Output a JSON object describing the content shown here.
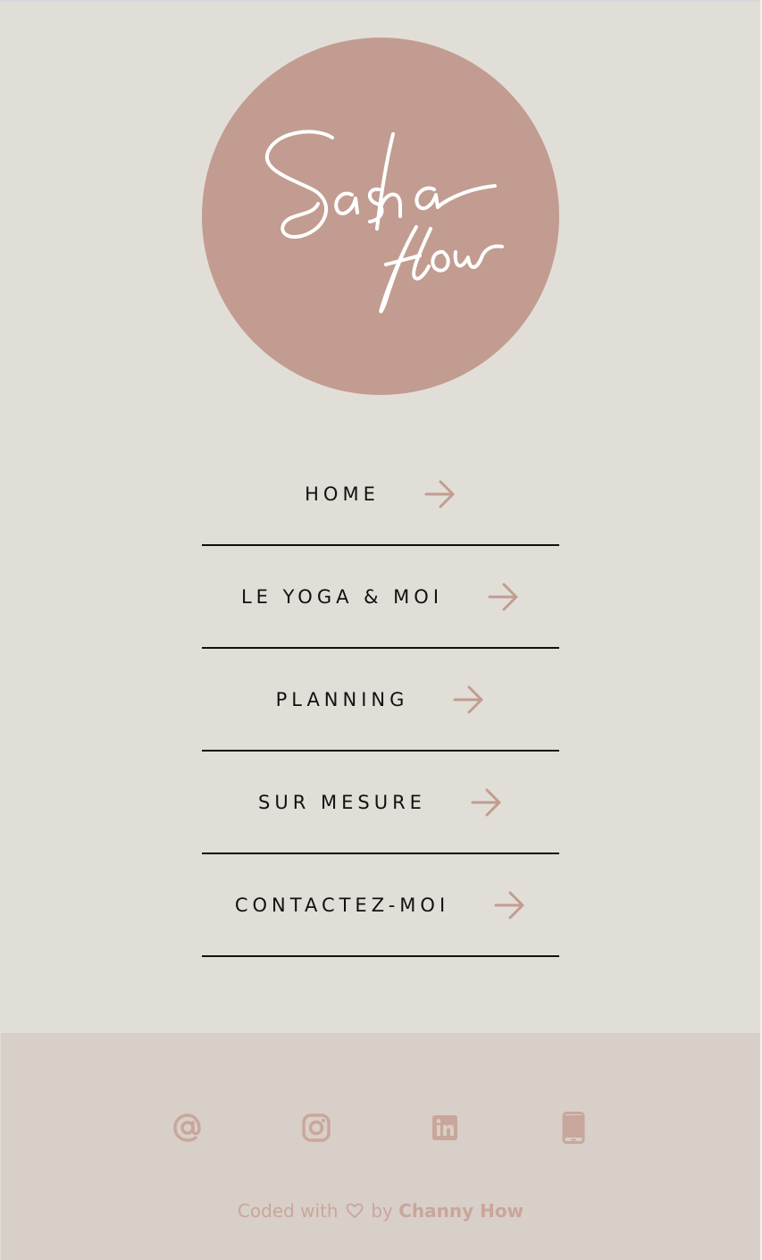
{
  "brand": {
    "logo_line1": "Sasha",
    "logo_line2": "flow",
    "circle_color": "#c29c90"
  },
  "nav": {
    "items": [
      {
        "label": "HOME",
        "icon": "arrow-right-icon"
      },
      {
        "label": "LE YOGA & MOI",
        "icon": "arrow-right-icon"
      },
      {
        "label": "PLANNING",
        "icon": "arrow-right-icon"
      },
      {
        "label": "SUR MESURE",
        "icon": "arrow-right-icon"
      },
      {
        "label": "CONTACTEZ-MOI",
        "icon": "arrow-right-icon"
      }
    ],
    "arrow_color": "#c29c90"
  },
  "footer": {
    "social": [
      {
        "name": "email-icon"
      },
      {
        "name": "instagram-icon"
      },
      {
        "name": "linkedin-icon"
      },
      {
        "name": "phone-icon"
      }
    ],
    "credit_prefix": "Coded with",
    "credit_by": "by",
    "credit_author": "Channy How",
    "icon_color": "#c9a69b",
    "background": "#d8cfc8"
  }
}
